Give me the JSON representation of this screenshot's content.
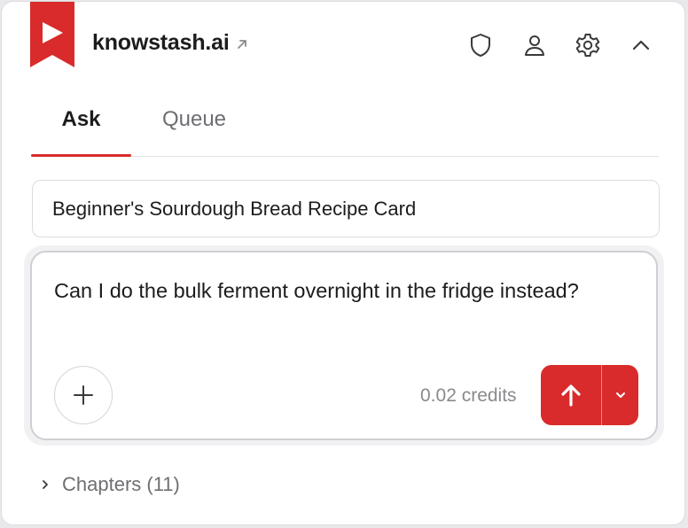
{
  "header": {
    "brand": "knowstash.ai",
    "icons": [
      "shield-icon",
      "user-icon",
      "gear-icon",
      "chevron-up-icon"
    ]
  },
  "tabs": [
    {
      "label": "Ask",
      "active": true
    },
    {
      "label": "Queue",
      "active": false
    }
  ],
  "document": {
    "title": "Beginner's Sourdough Bread Recipe Card"
  },
  "composer": {
    "question": "Can I do the bulk ferment overnight in the fridge instead?",
    "credits": "0.02 credits"
  },
  "chapters": {
    "label": "Chapters (11)"
  },
  "colors": {
    "accent": "#d92b2b",
    "text": "#1c1c1e",
    "muted": "#6e6e73"
  }
}
